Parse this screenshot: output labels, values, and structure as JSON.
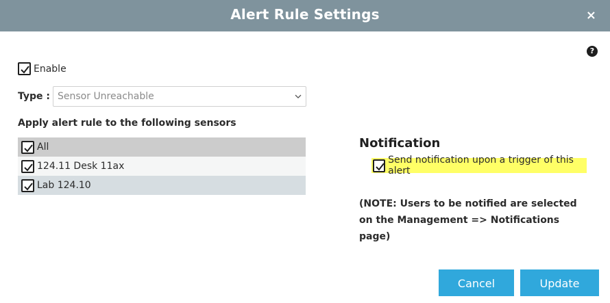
{
  "dialog": {
    "title": "Alert Rule Settings",
    "close_glyph": "×"
  },
  "help_icon": "?",
  "enable": {
    "label": "Enable",
    "checked": true
  },
  "type": {
    "label": "Type :",
    "selected": "Sensor Unreachable"
  },
  "sensors": {
    "heading": "Apply alert rule to the following sensors",
    "items": [
      {
        "label": "All",
        "checked": true
      },
      {
        "label": "124.11 Desk 11ax",
        "checked": true
      },
      {
        "label": "Lab 124.10",
        "checked": true
      }
    ]
  },
  "notification": {
    "title": "Notification",
    "send_label": "Send notification upon a trigger of this alert",
    "send_checked": true,
    "note": "(NOTE: Users to be notified are selected on the Management => Notifications page)"
  },
  "buttons": {
    "cancel": "Cancel",
    "update": "Update"
  },
  "colors": {
    "header_bg": "#7f939d",
    "button_bg": "#30a8dc",
    "highlight": "#ffff66"
  }
}
